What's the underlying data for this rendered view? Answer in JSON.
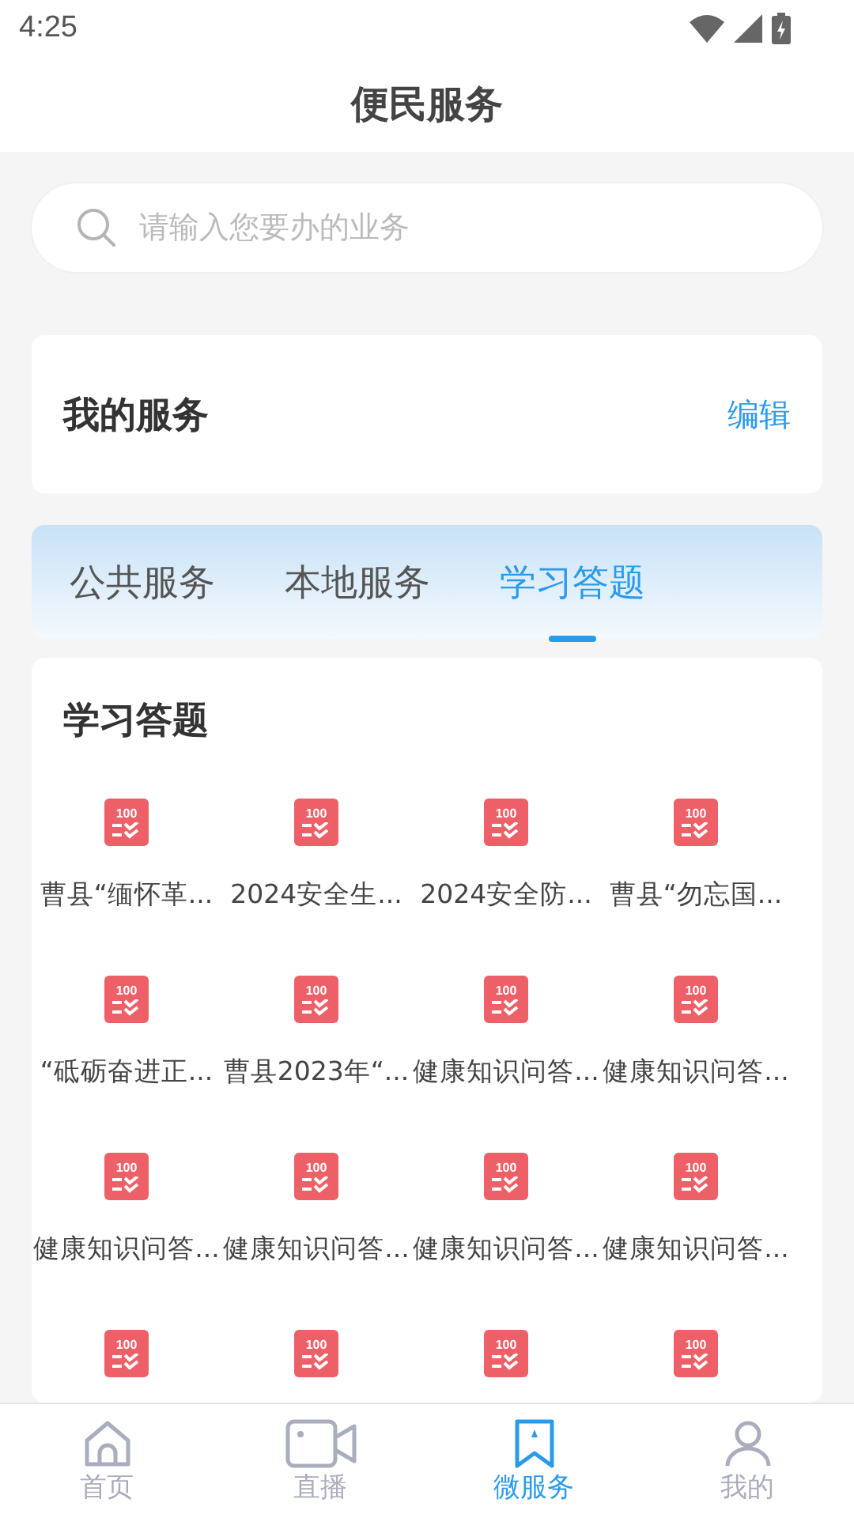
{
  "status_bar": {
    "time": "4:25"
  },
  "header": {
    "title": "便民服务"
  },
  "search": {
    "placeholder": "请输入您要办的业务"
  },
  "my_services": {
    "title": "我的服务",
    "action": "编辑"
  },
  "tabs": [
    {
      "label": "公共服务",
      "selected": false
    },
    {
      "label": "本地服务",
      "selected": false
    },
    {
      "label": "学习答题",
      "selected": true
    }
  ],
  "section": {
    "title": "学习答题",
    "items": [
      {
        "badge": "100",
        "label": "曹县“缅怀革..."
      },
      {
        "badge": "100",
        "label": "2024安全生..."
      },
      {
        "badge": "100",
        "label": "2024安全防..."
      },
      {
        "badge": "100",
        "label": "曹县“勿忘国..."
      },
      {
        "badge": "100",
        "label": "“砥砺奋进正..."
      },
      {
        "badge": "100",
        "label": "曹县2023年“..."
      },
      {
        "badge": "100",
        "label": "健康知识问答..."
      },
      {
        "badge": "100",
        "label": "健康知识问答..."
      },
      {
        "badge": "100",
        "label": "健康知识问答..."
      },
      {
        "badge": "100",
        "label": "健康知识问答..."
      },
      {
        "badge": "100",
        "label": "健康知识问答..."
      },
      {
        "badge": "100",
        "label": "健康知识问答..."
      },
      {
        "badge": "100"
      },
      {
        "badge": "100"
      },
      {
        "badge": "100"
      },
      {
        "badge": "100"
      }
    ]
  },
  "bottom_nav": [
    {
      "label": "首页",
      "kind": "home",
      "selected": false
    },
    {
      "label": "直播",
      "kind": "live",
      "selected": false
    },
    {
      "label": "微服务",
      "kind": "service",
      "selected": true
    },
    {
      "label": "我的",
      "kind": "me",
      "selected": false
    }
  ]
}
